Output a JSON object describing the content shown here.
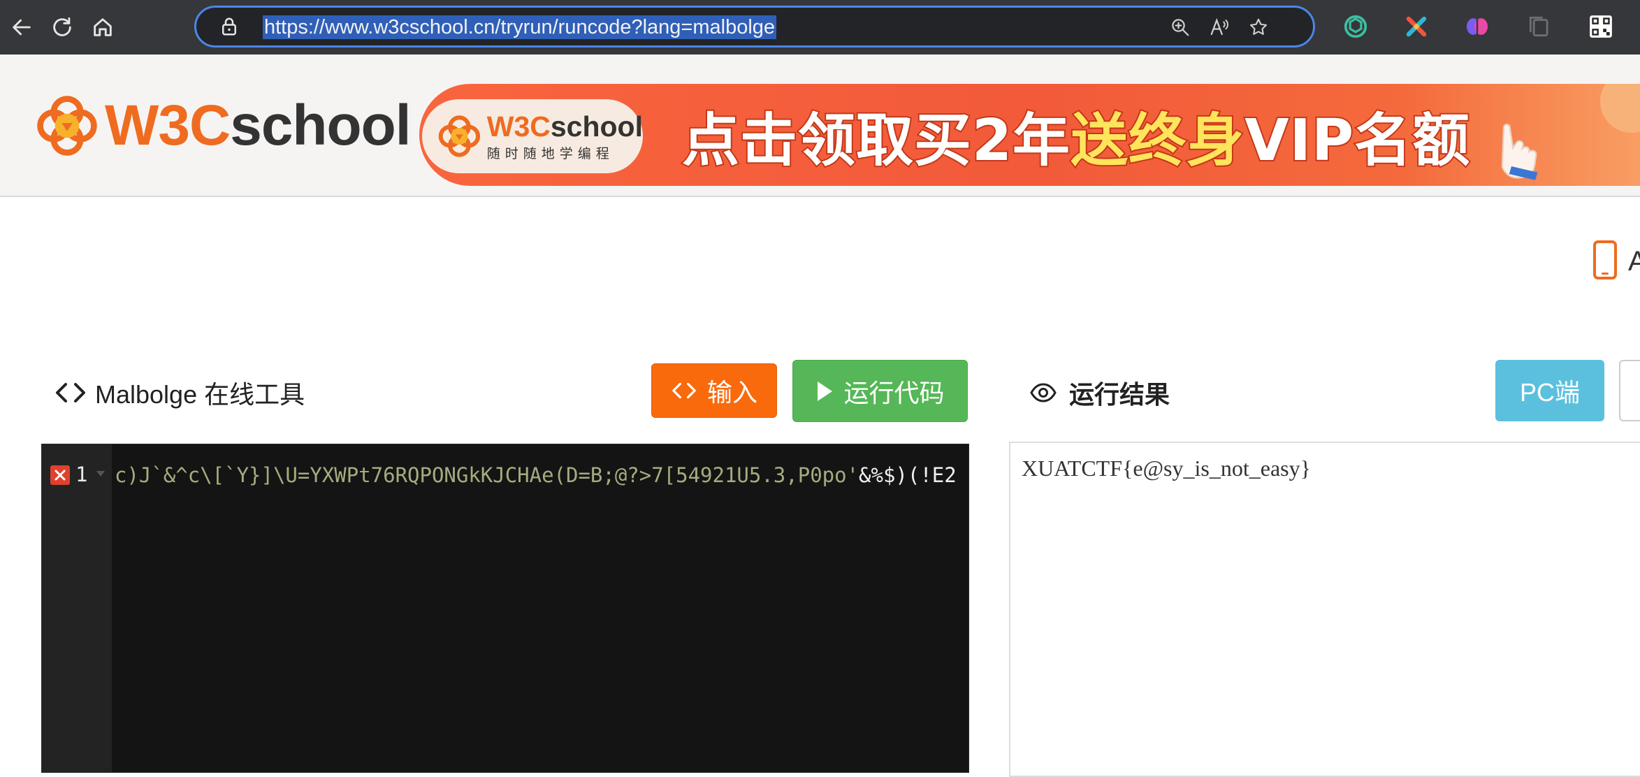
{
  "browser": {
    "url": "https://www.w3cschool.cn/tryrun/runcode?lang=malbolge",
    "back_icon": "back-arrow-icon",
    "refresh_icon": "refresh-icon",
    "home_icon": "home-icon",
    "lock_icon": "lock-icon",
    "zoom_icon": "zoom-icon",
    "read_aloud_icon": "read-aloud-icon",
    "favorite_icon": "star-icon",
    "extensions": [
      "chatgpt-icon",
      "x-extension-icon",
      "brain-icon",
      "collections-icon",
      "qr-code-icon"
    ],
    "accent": "#4b86e8"
  },
  "header": {
    "logo_w3c": "W3C",
    "logo_school": "school",
    "banner": {
      "pill_w3c": "W3C",
      "pill_school": "school",
      "pill_tagline": "随时随地学编程",
      "text_part1": "点击领取买2年",
      "text_part2": "送终身",
      "text_part3": "VIP名额"
    }
  },
  "page": {
    "phone_letter": "A",
    "tool_title": "Malbolge 在线工具",
    "input_button": "输入",
    "run_button": "运行代码",
    "result_title": "运行结果",
    "pc_button": "PC端"
  },
  "editor": {
    "line_number": "1",
    "code_string_part": "c)J`&^c\\[`Y}]\\U=YXWPt76RQPONGkKJCHAe(D=B;@?>7[54921U5.3,P0po'",
    "code_plain_part": "&%$)(!E2"
  },
  "output": {
    "text": "XUATCTF{e@sy_is_not_easy}"
  },
  "colors": {
    "orange": "#f96a0d",
    "green": "#55b757",
    "blue": "#5bc0de",
    "brand_orange": "#ef6b20"
  }
}
